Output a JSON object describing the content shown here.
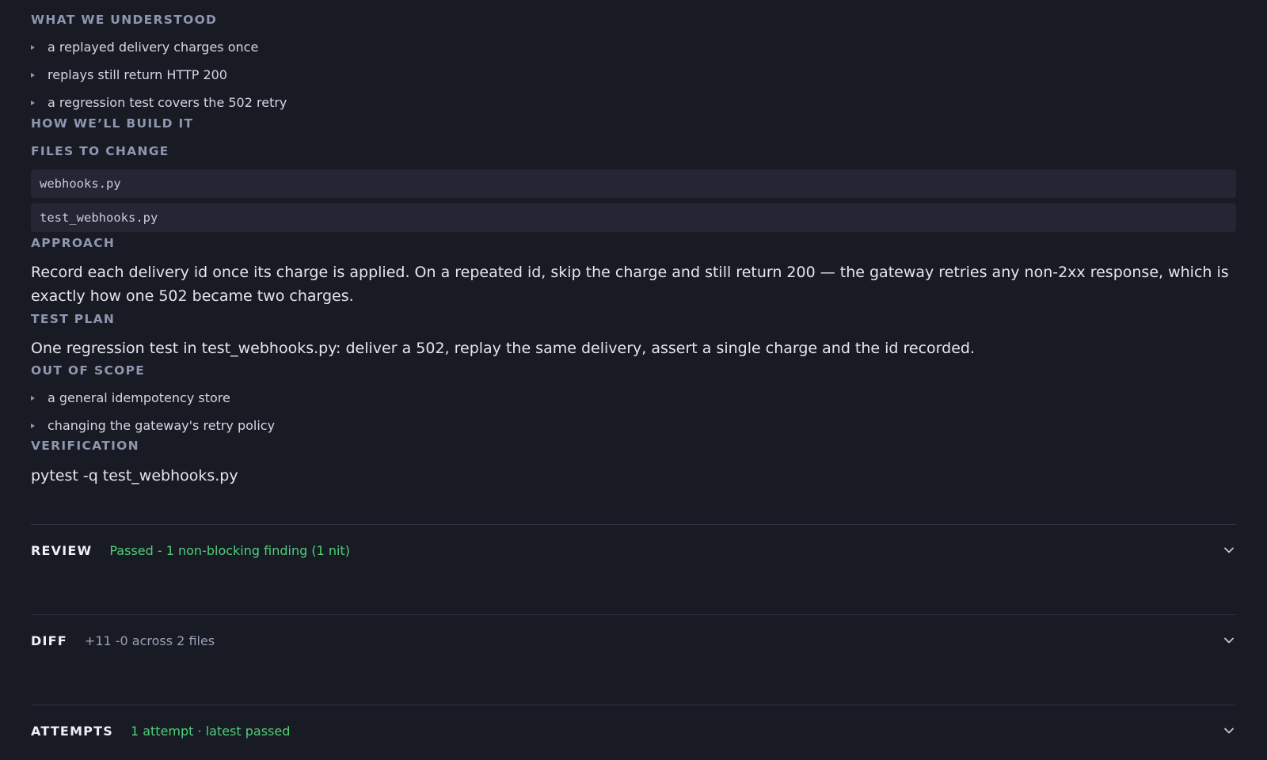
{
  "understood": {
    "heading": "WHAT WE UNDERSTOOD",
    "items": [
      "a replayed delivery charges once",
      "replays still return HTTP 200",
      "a regression test covers the 502 retry"
    ]
  },
  "build": {
    "heading": "HOW WE’LL BUILD IT"
  },
  "files": {
    "heading": "FILES TO CHANGE",
    "items": [
      "webhooks.py",
      "test_webhooks.py"
    ]
  },
  "approach": {
    "heading": "APPROACH",
    "text": "Record each delivery id once its charge is applied. On a repeated id, skip the charge and still return 200 — the gateway retries any non-2xx response, which is exactly how one 502 became two charges."
  },
  "test_plan": {
    "heading": "TEST PLAN",
    "text": "One regression test in test_webhooks.py: deliver a 502, replay the same delivery, assert a single charge and the id recorded."
  },
  "out_of_scope": {
    "heading": "OUT OF SCOPE",
    "items": [
      "a general idempotency store",
      "changing the gateway's retry policy"
    ]
  },
  "verification": {
    "heading": "VERIFICATION",
    "command": "pytest -q test_webhooks.py"
  },
  "panels": {
    "review": {
      "title": "REVIEW",
      "summary": "Passed - 1 non-blocking finding (1 nit)",
      "icon": "chevron-down-icon"
    },
    "diff": {
      "title": "DIFF",
      "summary": "+11 -0 across 2 files",
      "icon": "chevron-down-icon"
    },
    "attempts": {
      "title": "ATTEMPTS",
      "summary": "1 attempt · latest passed",
      "icon": "chevron-down-icon"
    }
  },
  "colors": {
    "background": "#181a24",
    "heading": "#8e96b0",
    "success": "#4fcf78",
    "code_bg": "#242633"
  }
}
